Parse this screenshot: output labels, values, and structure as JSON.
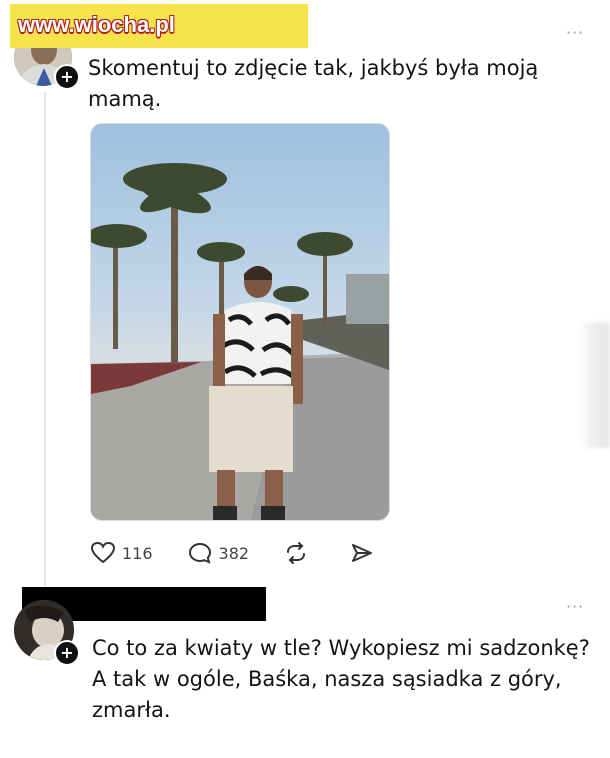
{
  "watermark": {
    "text": "www.wiocha.pl"
  },
  "posts": [
    {
      "text": "Skomentuj to zdjęcie tak, jakbyś była moją mamą.",
      "more_icon": "more-horizontal-icon",
      "avatar_badge": "+",
      "actions": {
        "like": {
          "icon": "heart-icon",
          "count": "116"
        },
        "reply": {
          "icon": "comment-icon",
          "count": "382"
        },
        "repost": {
          "icon": "repost-icon"
        },
        "share": {
          "icon": "send-icon"
        }
      }
    },
    {
      "text": "Co to za kwiaty w tle? Wykopiesz mi sadzonkę? A tak w ogóle, Baśka, nasza sąsiadka z góry, zmarła.",
      "more_icon": "more-horizontal-icon",
      "avatar_badge": "+"
    }
  ],
  "more_dots": "···",
  "colors": {
    "watermark_bg": "#f7e34a",
    "watermark_outline": "#b02020",
    "text": "#141414",
    "muted": "#444444"
  }
}
